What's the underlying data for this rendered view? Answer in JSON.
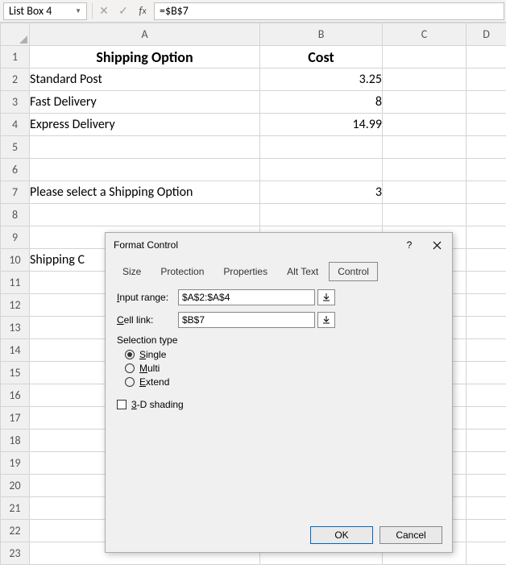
{
  "formula_bar": {
    "name_box": "List Box 4",
    "formula": "=$B$7"
  },
  "columns": [
    "A",
    "B",
    "C",
    "D"
  ],
  "rows": {
    "r1": {
      "A": "Shipping Option",
      "B": "Cost"
    },
    "r2": {
      "A": "Standard Post",
      "B": "3.25"
    },
    "r3": {
      "A": "Fast Delivery",
      "B": "8"
    },
    "r4": {
      "A": "Express Delivery",
      "B": "14.99"
    },
    "r7": {
      "A": "Please select a Shipping Option",
      "B": "3"
    },
    "r10": {
      "A": "Shipping C"
    }
  },
  "row_numbers": [
    "1",
    "2",
    "3",
    "4",
    "5",
    "6",
    "7",
    "8",
    "9",
    "10",
    "11",
    "12",
    "13",
    "14",
    "15",
    "16",
    "17",
    "18",
    "19",
    "20",
    "21",
    "22",
    "23"
  ],
  "dialog": {
    "title": "Format Control",
    "tabs": {
      "size": "Size",
      "protection": "Protection",
      "properties": "Properties",
      "alttext": "Alt Text",
      "control": "Control"
    },
    "active_tab": "Control",
    "input_range_label_pre": "I",
    "input_range_label": "nput range:",
    "cell_link_label_pre": "C",
    "cell_link_label": "ell link:",
    "input_range_value": "$A$2:$A$4",
    "cell_link_value": "$B$7",
    "selection_type_label": "Selection type",
    "radio_single_pre": "S",
    "radio_single": "ingle",
    "radio_multi_pre": "M",
    "radio_multi": "ulti",
    "radio_extend_pre": "E",
    "radio_extend": "xtend",
    "checkbox_3d_pre": "3",
    "checkbox_3d": "-D shading",
    "ok": "OK",
    "cancel": "Cancel"
  }
}
